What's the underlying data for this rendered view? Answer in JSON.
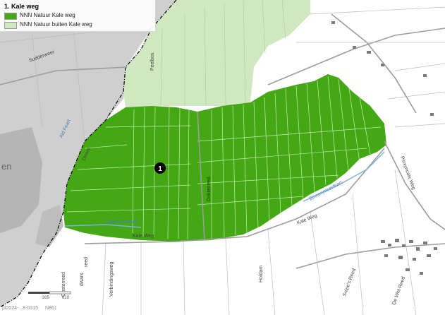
{
  "legend": {
    "title": "1. Kale weg",
    "items": [
      {
        "label": "NNN Natuur Kale weg",
        "color": "#43a813"
      },
      {
        "label": "NNN Natuur buiten Kale weg",
        "color": "#cfe8bf"
      }
    ]
  },
  "area_marker": "1",
  "place_labels": {
    "sudderweg": "Sudderweer",
    "peelbos": "Peelbos",
    "oude_feart": "Ald Feart",
    "dwers": "Dwers",
    "den": "en",
    "dokkummerfeart": "Dokkumerfeart",
    "kale_weg_1": "Kale Weg",
    "kale_weg_2": "Kale Weg",
    "dokterreed": "Dokterreed",
    "binnenvaart": "Binnenmeerfeart",
    "pinxweg": "Pinxyncale Weg",
    "oosterdwarsreed": "Oosterreed",
    "dwars2": "dwars",
    "verbindingsweg": "Verbindingsweg",
    "holdam": "Holdam",
    "snipesreed": "Snipe's Reed",
    "dewetreed": "De Wet Reed",
    "reed": "reed"
  },
  "scale": {
    "tick1": "305",
    "tick2": "610"
  },
  "footer": {
    "id": "pl2024-...8-0315",
    "north": "N861"
  },
  "colors": {
    "core": "#43a813",
    "outer": "#cfe8bf",
    "builtup": "#b9b9b9",
    "rural": "#e3e3e3",
    "road": "#9c9c9c",
    "water": "#7fb0d9",
    "boundary": "#000000"
  }
}
